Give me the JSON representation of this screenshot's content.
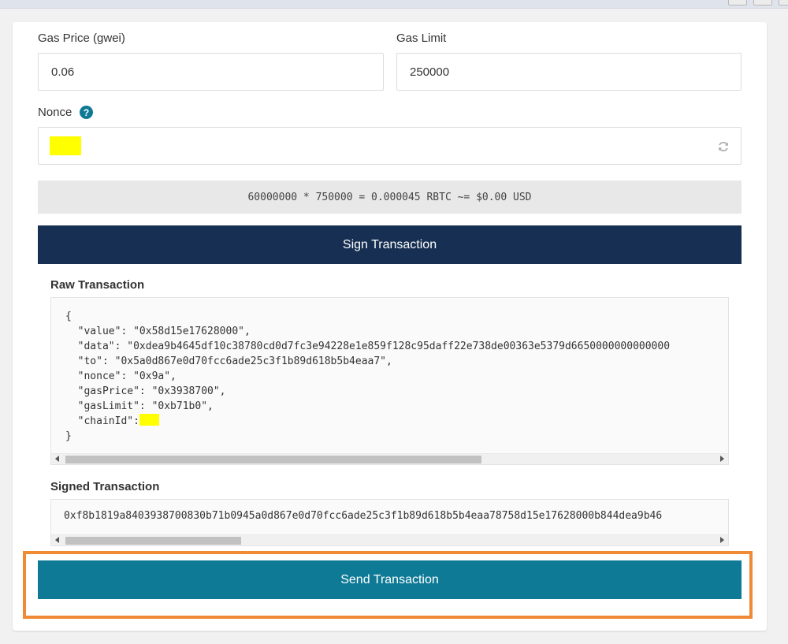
{
  "gas_price": {
    "label": "Gas Price (gwei)",
    "value": "0.06"
  },
  "gas_limit": {
    "label": "Gas Limit",
    "value": "250000"
  },
  "nonce": {
    "label": "Nonce",
    "help_glyph": "?",
    "value": "",
    "refresh_icon": "refresh-icon"
  },
  "cost_summary": "60000000 * 750000 = 0.000045 RBTC ~= $0.00 USD",
  "sign_button": {
    "label": "Sign Transaction"
  },
  "raw_transaction": {
    "title": "Raw Transaction",
    "open": "{",
    "value_key": "  \"value\": ",
    "value": "\"0x58d15e17628000\",",
    "data_key": "  \"data\": ",
    "data": "\"0xdea9b4645df10c38780cd0d7fc3e94228e1e859f128c95daff22e738de00363e5379d6650000000000000",
    "to_key": "  \"to\": ",
    "to": "\"0x5a0d867e0d70fcc6ade25c3f1b89d618b5b4eaa7\",",
    "nonce_key": "  \"nonce\": ",
    "nonce": "\"0x9a\",",
    "gasPrice_key": "  \"gasPrice\": ",
    "gasPrice": "\"0x3938700\",",
    "gasLimit_key": "  \"gasLimit\": ",
    "gasLimit": "\"0xb71b0\",",
    "chainId_key": "  \"chainId\":",
    "close": "}",
    "scroll_thumb_fraction": 0.64
  },
  "signed_transaction": {
    "title": "Signed Transaction",
    "value": "0xf8b1819a8403938700830b71b0945a0d867e0d70fcc6ade25c3f1b89d618b5b4eaa78758d15e17628000b844dea9b46",
    "scroll_thumb_fraction": 0.27
  },
  "send_button": {
    "label": "Send Transaction"
  },
  "colors": {
    "sign_button_bg": "#172f52",
    "send_button_bg": "#0e7a96",
    "highlight": "#ffff00",
    "focus_ring": "#f08a35"
  }
}
